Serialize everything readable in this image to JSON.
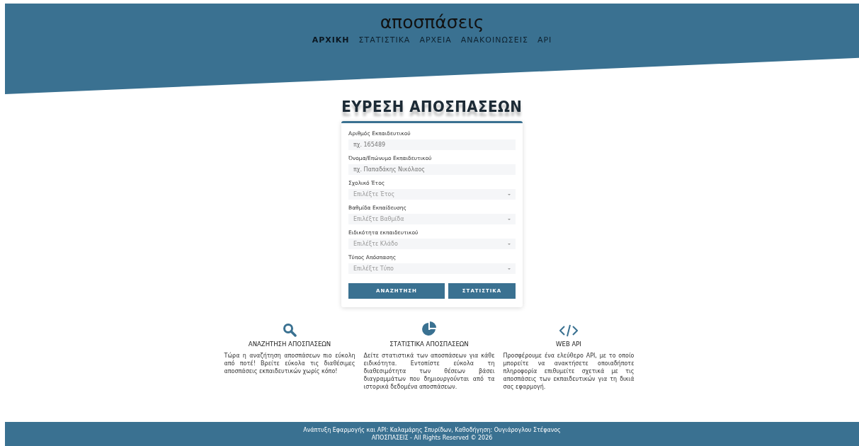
{
  "header": {
    "logo": "αποσπάσεις",
    "nav": [
      {
        "label": "ΑΡΧΙΚΗ",
        "selected": true
      },
      {
        "label": "ΣΤΑΤΙΣΤΙΚΑ",
        "selected": false
      },
      {
        "label": "ΑΡΧΕΙΑ",
        "selected": false
      },
      {
        "label": "ΑΝΑΚΟΙΝΩΣΕΙΣ",
        "selected": false
      },
      {
        "label": "API",
        "selected": false
      }
    ]
  },
  "search": {
    "title": "ΕΥΡΕΣΗ ΑΠΟΣΠΑΣΕΩΝ",
    "fields": [
      {
        "kind": "text",
        "label": "Αριθμός Εκπαιδευτικού",
        "placeholder": "πχ. 165489"
      },
      {
        "kind": "text",
        "label": "Όνομα/Επώνυμο Εκπαιδευτικού",
        "placeholder": "πχ. Παπαδάκης Νικόλαος"
      },
      {
        "kind": "select",
        "label": "Σχολικό Έτος",
        "placeholder": "Επιλέξτε Έτος"
      },
      {
        "kind": "select",
        "label": "Βαθμίδα Εκπαίδευσης",
        "placeholder": "Επιλέξτε Βαθμίδα"
      },
      {
        "kind": "select",
        "label": "Ειδικότητα εκπαιδευτικού",
        "placeholder": "Επιλέξτε Κλάδο"
      },
      {
        "kind": "select",
        "label": "Τύπος Απόσπασης",
        "placeholder": "Επιλέξτε Τύπο"
      }
    ],
    "buttons": [
      "ΑΝΑΖΗΤΗΣΗ",
      "ΣΤΑΤΙΣΤΙΚΑ"
    ]
  },
  "features": [
    {
      "kind": "search",
      "title": "ΑΝΑΖΗΤΗΣΗ ΑΠΟΣΠΑΣΕΩΝ",
      "text": "Τώρα η αναζήτηση αποσπάσεων πιο εύκολη από ποτέ! Βρείτε εύκολα τις διαθέσιμες αποσπάσεις εκπαιδευτικών χωρίς κόπο!"
    },
    {
      "kind": "chart",
      "title": "ΣΤΑΤΙΣΤΙΚΑ ΑΠΟΣΠΑΣΕΩΝ",
      "text": "Δείτε στατιστικά των αποσπάσεων για κάθε ειδικότητα. Εντοπίστε εύκολα τη διαθεσιμότητα των θέσεων βάσει διαγραμμάτων που δημιουργούνται από τα ιστορικά δεδομένα αποσπάσεων."
    },
    {
      "kind": "code",
      "title": "WEB API",
      "text": "Προσφέρουμε ένα ελεύθερο API, με το οποίο μπορείτε να ανακτήσετε οποιαδήποτε πληροφορία επιθυμείτε σχετικά με τις αποσπάσεις των εκπαιδευτικών για τη δικιά σας εφαρμογή."
    }
  ],
  "footer": [
    "Ανάπτυξη Εφαρμογής και API: Καλαμάρης Σπυρίδων, Καθοδήγηση: Ουγιάρογλου Στέφανος",
    "ΑΠΟΣΠΑΣΕΙΣ - All Rights Reserved © 2026"
  ]
}
